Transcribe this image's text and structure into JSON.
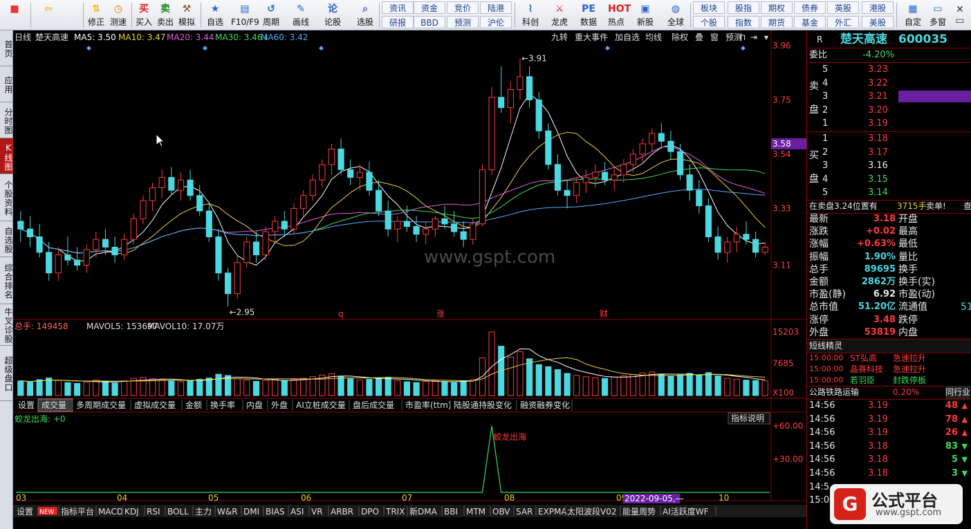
{
  "toolbar": {
    "main": [
      {
        "label": "",
        "icon": "windows-logo-icon"
      },
      {
        "label": "",
        "icon": "back-arrow-icon"
      },
      {
        "label": "修正",
        "icon": "arrows-updown-icon"
      },
      {
        "label": "测速",
        "icon": "clock-icon"
      },
      {
        "label": "买入",
        "icon": "buy-icon",
        "glyph": "买"
      },
      {
        "label": "卖出",
        "icon": "sell-icon",
        "glyph": "卖"
      },
      {
        "label": "模拟",
        "icon": "hammer-icon"
      },
      {
        "label": "自选",
        "icon": "star-folder-icon"
      },
      {
        "label": "F10/F9",
        "icon": "f10-icon"
      },
      {
        "label": "周期",
        "icon": "period-icon"
      },
      {
        "label": "画线",
        "icon": "pencil-icon"
      },
      {
        "label": "论股",
        "icon": "forum-icon"
      },
      {
        "label": "选股",
        "icon": "select-stock-icon"
      }
    ],
    "grid": [
      [
        "资讯",
        "资金",
        "竞价",
        "陆港"
      ],
      [
        "研报",
        "BBD",
        "预测",
        "沪伦"
      ]
    ],
    "mid": [
      {
        "label": "科创",
        "icon": "kechuang-icon"
      },
      {
        "label": "龙虎",
        "icon": "dragon-tiger-icon"
      },
      {
        "label": "数据",
        "icon": "pe-data-icon",
        "glyph": "PE"
      },
      {
        "label": "热点",
        "icon": "hot-icon",
        "glyph": "HOT"
      },
      {
        "label": "新股",
        "icon": "new-stock-icon"
      },
      {
        "label": "全球",
        "icon": "globe-icon"
      }
    ],
    "grid2": [
      [
        "板块",
        "股指",
        "期权",
        "债券",
        "英股",
        "港股"
      ],
      [
        "个股",
        "指数",
        "期货",
        "基金",
        "外汇",
        "美股"
      ]
    ],
    "right": [
      {
        "label": "自定",
        "icon": "customize-icon"
      },
      {
        "label": "多窗",
        "icon": "multi-window-icon"
      }
    ]
  },
  "leftnav": [
    "首页",
    "应用",
    "分时图",
    "K线图",
    "个股资料",
    "自选股",
    "综合排名",
    "牛叉诊股",
    "超级盘口"
  ],
  "chart": {
    "header": {
      "period": "日线",
      "name": "楚天高速",
      "ma5": "MA5: 3.50",
      "ma10": "MA10: 3.47",
      "ma20": "MA20: 3.44",
      "ma30": "MA30: 3.46",
      "ma60": "MA60: 3.42",
      "arrow_ma30": "↓"
    },
    "top_buttons": [
      "九转",
      "重大事件",
      "加自选",
      "均线",
      "除权",
      "叠",
      "窗",
      "预测"
    ],
    "price_axis": [
      "3.96",
      "3.75",
      "3.54",
      "3.33",
      "3.11"
    ],
    "current_price_tag": "3.58",
    "high_label": "3.91",
    "low_label": "2.95",
    "event_marks": [
      "q",
      "涨",
      "财"
    ],
    "watermark": "www.gspt.com",
    "volume_header": {
      "total": "总手: 149458",
      "mavol5": "MAVOL5: 153697",
      "mavol10": "MAVOL10: 17.07万"
    },
    "volume_axis": [
      "15203",
      "7685",
      "X100"
    ],
    "indicator_tabs": [
      "设置",
      "成交量",
      "多周期成交量",
      "虚拟成交量",
      "金额",
      "换手率",
      "内盘",
      "外盘",
      "AI立桩成交量",
      "盘后成交量",
      "市盈率(ttm)",
      "陆股通持股变化",
      "融资融券变化"
    ],
    "indicator": {
      "title": "蛟龙出海: +0",
      "help": "指标说明",
      "signal_label": "蛟龙出海",
      "axis": [
        "+60.00",
        "+30.00"
      ]
    },
    "months": [
      "03",
      "04",
      "05",
      "06",
      "07",
      "08",
      "09",
      "10"
    ],
    "cursor_date": "2022-09-05,—",
    "bottom_tabs": [
      "设置",
      "NEW",
      "指标平台",
      "MACD",
      "KDJ",
      "RSI",
      "BOLL",
      "主力",
      "W&R",
      "DMI",
      "BIAS",
      "ASI",
      "VR",
      "ARBR",
      "DPO",
      "TRIX",
      "新DMA",
      "BBI",
      "MTM",
      "OBV",
      "SAR",
      "EXPMA",
      "太阳波段V02",
      "能量周势",
      "AI活跃度WF"
    ]
  },
  "chart_data": {
    "type": "candlestick",
    "title": "楚天高速 日线",
    "price_range": [
      2.9,
      3.96
    ],
    "volume_range": [
      0,
      15203
    ],
    "high": 3.91,
    "low": 2.95,
    "ma": {
      "MA5": 3.5,
      "MA10": 3.47,
      "MA20": 3.44,
      "MA30": 3.46,
      "MA60": 3.42
    },
    "candles": [
      [
        3.28,
        3.32,
        3.2,
        3.25
      ],
      [
        3.25,
        3.3,
        3.18,
        3.22
      ],
      [
        3.22,
        3.27,
        3.14,
        3.16
      ],
      [
        3.16,
        3.2,
        3.05,
        3.08
      ],
      [
        3.08,
        3.18,
        3.05,
        3.15
      ],
      [
        3.15,
        3.22,
        3.11,
        3.13
      ],
      [
        3.13,
        3.18,
        3.09,
        3.11
      ],
      [
        3.11,
        3.19,
        3.08,
        3.17
      ],
      [
        3.17,
        3.24,
        3.14,
        3.21
      ],
      [
        3.21,
        3.25,
        3.15,
        3.18
      ],
      [
        3.18,
        3.22,
        3.12,
        3.15
      ],
      [
        3.15,
        3.23,
        3.13,
        3.21
      ],
      [
        3.21,
        3.31,
        3.19,
        3.29
      ],
      [
        3.29,
        3.38,
        3.27,
        3.36
      ],
      [
        3.36,
        3.43,
        3.32,
        3.41
      ],
      [
        3.41,
        3.48,
        3.37,
        3.45
      ],
      [
        3.45,
        3.49,
        3.38,
        3.4
      ],
      [
        3.4,
        3.47,
        3.36,
        3.44
      ],
      [
        3.44,
        3.48,
        3.36,
        3.38
      ],
      [
        3.38,
        3.42,
        3.3,
        3.32
      ],
      [
        3.32,
        3.35,
        3.2,
        3.22
      ],
      [
        3.22,
        3.25,
        3.05,
        3.08
      ],
      [
        3.08,
        3.1,
        2.95,
        3.0
      ],
      [
        3.0,
        3.15,
        2.98,
        3.12
      ],
      [
        3.12,
        3.22,
        3.1,
        3.2
      ],
      [
        3.2,
        3.24,
        3.12,
        3.15
      ],
      [
        3.15,
        3.26,
        3.13,
        3.24
      ],
      [
        3.24,
        3.3,
        3.2,
        3.28
      ],
      [
        3.28,
        3.32,
        3.22,
        3.25
      ],
      [
        3.25,
        3.35,
        3.23,
        3.33
      ],
      [
        3.33,
        3.4,
        3.3,
        3.38
      ],
      [
        3.38,
        3.46,
        3.36,
        3.44
      ],
      [
        3.44,
        3.52,
        3.41,
        3.5
      ],
      [
        3.5,
        3.58,
        3.46,
        3.56
      ],
      [
        3.56,
        3.6,
        3.46,
        3.48
      ],
      [
        3.48,
        3.52,
        3.42,
        3.45
      ],
      [
        3.45,
        3.5,
        3.4,
        3.47
      ],
      [
        3.47,
        3.51,
        3.38,
        3.4
      ],
      [
        3.4,
        3.44,
        3.3,
        3.32
      ],
      [
        3.32,
        3.36,
        3.22,
        3.25
      ],
      [
        3.25,
        3.3,
        3.2,
        3.28
      ],
      [
        3.28,
        3.34,
        3.24,
        3.26
      ],
      [
        3.26,
        3.3,
        3.2,
        3.23
      ],
      [
        3.23,
        3.28,
        3.19,
        3.25
      ],
      [
        3.25,
        3.3,
        3.22,
        3.29
      ],
      [
        3.29,
        3.34,
        3.25,
        3.27
      ],
      [
        3.27,
        3.32,
        3.22,
        3.24
      ],
      [
        3.24,
        3.28,
        3.18,
        3.21
      ],
      [
        3.21,
        3.29,
        3.19,
        3.27
      ],
      [
        3.27,
        3.5,
        3.26,
        3.48
      ],
      [
        3.48,
        3.8,
        3.46,
        3.76
      ],
      [
        3.76,
        3.88,
        3.7,
        3.72
      ],
      [
        3.72,
        3.82,
        3.66,
        3.79
      ],
      [
        3.79,
        3.91,
        3.75,
        3.84
      ],
      [
        3.84,
        3.88,
        3.72,
        3.75
      ],
      [
        3.75,
        3.78,
        3.6,
        3.63
      ],
      [
        3.63,
        3.66,
        3.48,
        3.5
      ],
      [
        3.5,
        3.54,
        3.38,
        3.4
      ],
      [
        3.4,
        3.44,
        3.33,
        3.38
      ],
      [
        3.38,
        3.45,
        3.35,
        3.43
      ],
      [
        3.43,
        3.48,
        3.39,
        3.45
      ],
      [
        3.45,
        3.5,
        3.41,
        3.47
      ],
      [
        3.47,
        3.51,
        3.42,
        3.44
      ],
      [
        3.44,
        3.49,
        3.4,
        3.46
      ],
      [
        3.46,
        3.52,
        3.43,
        3.5
      ],
      [
        3.5,
        3.56,
        3.47,
        3.54
      ],
      [
        3.54,
        3.6,
        3.51,
        3.58
      ],
      [
        3.58,
        3.64,
        3.55,
        3.62
      ],
      [
        3.62,
        3.66,
        3.56,
        3.59
      ],
      [
        3.59,
        3.63,
        3.52,
        3.55
      ],
      [
        3.55,
        3.58,
        3.44,
        3.46
      ],
      [
        3.46,
        3.5,
        3.36,
        3.4
      ],
      [
        3.4,
        3.44,
        3.31,
        3.34
      ],
      [
        3.34,
        3.37,
        3.2,
        3.22
      ],
      [
        3.22,
        3.26,
        3.13,
        3.16
      ],
      [
        3.16,
        3.22,
        3.12,
        3.2
      ],
      [
        3.2,
        3.26,
        3.16,
        3.23
      ],
      [
        3.23,
        3.28,
        3.19,
        3.21
      ],
      [
        3.21,
        3.24,
        3.14,
        3.16
      ],
      [
        3.16,
        3.2,
        3.15,
        3.18
      ]
    ],
    "volumes": [
      3500,
      3200,
      3800,
      4200,
      3600,
      3100,
      2900,
      3300,
      3700,
      3400,
      3000,
      3500,
      4100,
      4300,
      4000,
      3800,
      3500,
      3300,
      3600,
      3900,
      4200,
      5100,
      4800,
      4000,
      3700,
      3400,
      3600,
      3900,
      3500,
      3800,
      4100,
      4500,
      4900,
      5200,
      4600,
      4000,
      3700,
      3900,
      4200,
      4400,
      3600,
      3300,
      3100,
      3400,
      3600,
      3300,
      3100,
      3500,
      3800,
      9000,
      15203,
      11800,
      9200,
      10500,
      8800,
      7400,
      6900,
      6200,
      5300,
      4800,
      4500,
      4300,
      4100,
      4400,
      4700,
      5000,
      5400,
      5600,
      5000,
      4600,
      4900,
      5300,
      4800,
      5500,
      4700,
      4100,
      3900,
      3700,
      3600,
      3500
    ],
    "indicator": {
      "name": "蛟龙出海",
      "value": 0,
      "signal_index": 50,
      "signal_value": 60
    }
  },
  "right_panel": {
    "code_prefix": "R",
    "name": "楚天高速",
    "code": "600035",
    "weibi_label": "委比",
    "weibi": "-4.20%",
    "sell_label": [
      "卖",
      "盘"
    ],
    "buy_label": [
      "买",
      "盘"
    ],
    "sell": [
      {
        "lv": "5",
        "p": "3.23"
      },
      {
        "lv": "4",
        "p": "3.22"
      },
      {
        "lv": "3",
        "p": "3.21"
      },
      {
        "lv": "2",
        "p": "3.20"
      },
      {
        "lv": "1",
        "p": "3.19"
      }
    ],
    "buy": [
      {
        "lv": "1",
        "p": "3.18"
      },
      {
        "lv": "2",
        "p": "3.17"
      },
      {
        "lv": "3",
        "p": "3.16"
      },
      {
        "lv": "4",
        "p": "3.15"
      },
      {
        "lv": "5",
        "p": "3.14"
      }
    ],
    "status": {
      "text": "在卖盘3.24位置有",
      "vol": "3715手",
      "tail": "卖单!",
      "cut": "查"
    },
    "quote": [
      {
        "l": "最新",
        "v": "3.18",
        "l2": "开盘",
        "v2": ""
      },
      {
        "l": "涨跌",
        "v": "+0.02",
        "l2": "最高",
        "v2": ""
      },
      {
        "l": "涨幅",
        "v": "+0.63%",
        "l2": "最低",
        "v2": ""
      },
      {
        "l": "振幅",
        "v": "1.90%",
        "l2": "量比",
        "v2": ""
      },
      {
        "l": "总手",
        "v": "89695",
        "l2": "换手",
        "v2": ""
      },
      {
        "l": "金额",
        "v": "2862万",
        "l2": "换手(实)",
        "v2": ""
      },
      {
        "l": "市盈(静)",
        "v": "6.92",
        "l2": "市盈(动)",
        "v2": ""
      },
      {
        "l": "总市值",
        "v": "51.20亿",
        "l2": "流通值",
        "v2": "51"
      },
      {
        "l": "涨停",
        "v": "3.48",
        "l2": "跌停",
        "v2": ""
      },
      {
        "l": "外盘",
        "v": "53819",
        "l2": "内盘",
        "v2": ""
      }
    ],
    "sprite_title": "短线精灵",
    "sprite": [
      {
        "t": "15:00:00",
        "n": "ST弘高",
        "e": "急速拉升"
      },
      {
        "t": "15:00:00",
        "n": "晶赛科技",
        "e": "急速拉升"
      },
      {
        "t": "15:00:00",
        "n": "若羽臣",
        "e": "封跌停板"
      }
    ],
    "industry": {
      "name": "公路铁路运输",
      "pct": "0.20%",
      "tab": "同行业"
    },
    "ticks": [
      {
        "t": "14:56",
        "p": "3.19",
        "v": "48",
        "d": "up"
      },
      {
        "t": "14:56",
        "p": "3.19",
        "v": "78",
        "d": "up"
      },
      {
        "t": "14:56",
        "p": "3.19",
        "v": "26",
        "d": "up"
      },
      {
        "t": "14:56",
        "p": "3.18",
        "v": "83",
        "d": "down"
      },
      {
        "t": "14:56",
        "p": "3.18",
        "v": "5",
        "d": "down"
      },
      {
        "t": "14:56",
        "p": "3.18",
        "v": "3",
        "d": "down"
      },
      {
        "t": "14:5",
        "p": "",
        "v": "",
        "d": ""
      },
      {
        "t": "15:0",
        "p": "",
        "v": "",
        "d": ""
      }
    ]
  },
  "brand": {
    "name": "公式平台",
    "url": "www.gspt.com"
  },
  "colors": {
    "up": "#ff3b3b",
    "down": "#4cd8e0",
    "ma5": "#ffffff",
    "ma10": "#e8d23a",
    "ma20": "#e060e0",
    "ma30": "#3ddc5a",
    "ma60": "#5aa9ff",
    "accent": "#6a1fa0"
  }
}
